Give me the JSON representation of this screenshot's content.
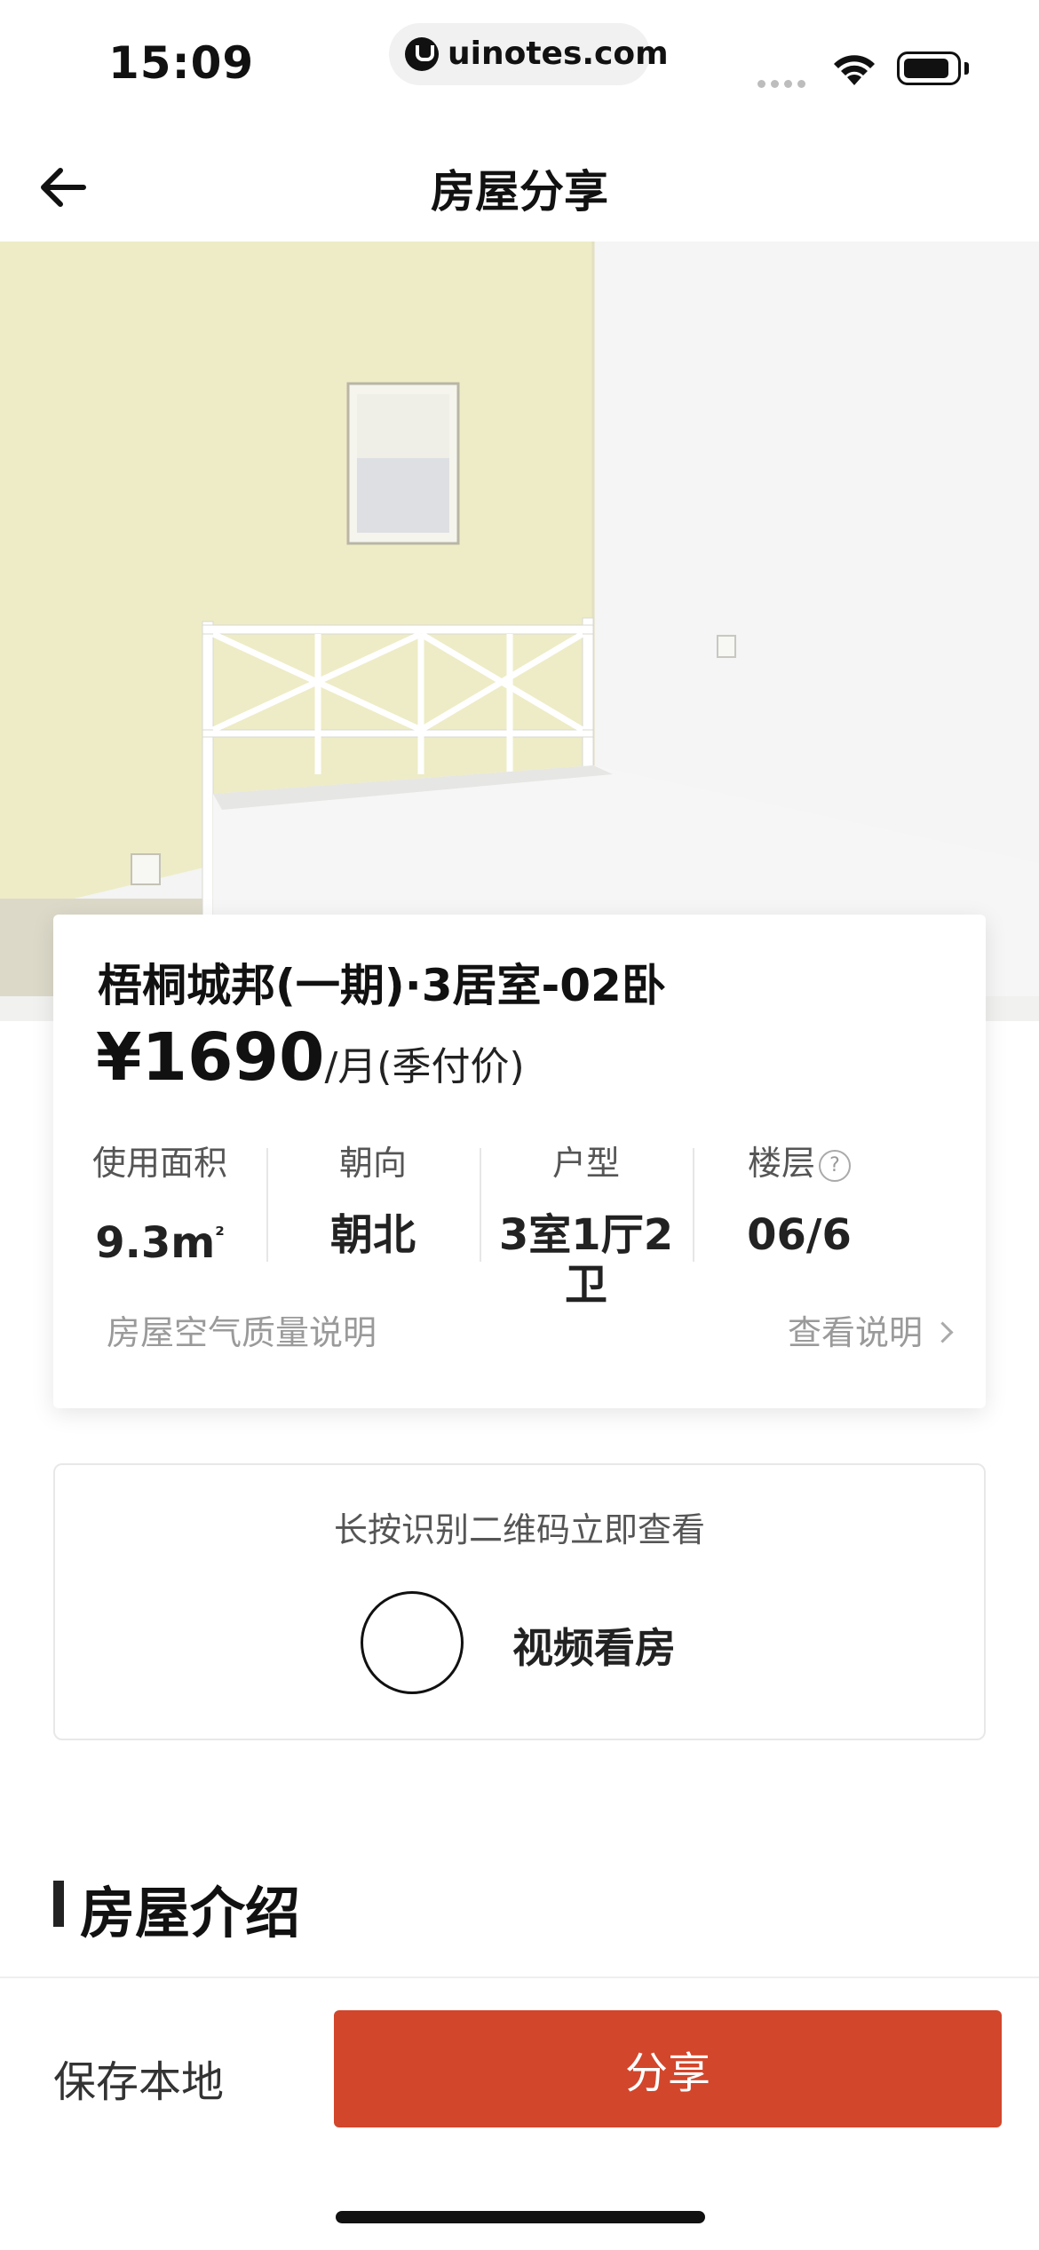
{
  "status_bar": {
    "time": "15:09",
    "url": "uinotes.com"
  },
  "navbar": {
    "title": "房屋分享"
  },
  "listing": {
    "title": "梧桐城邦(一期)·3居室-02卧",
    "price": "¥1690",
    "price_unit": "/月(季付价)",
    "specs": [
      {
        "label": "使用面积",
        "value": "9.3m",
        "value_sup": "²"
      },
      {
        "label": "朝向",
        "value": "朝北"
      },
      {
        "label": "户型",
        "value": "3室1厅2卫"
      },
      {
        "label": "楼层",
        "value": "06/6",
        "help": "?"
      }
    ],
    "air_quality_label": "房屋空气质量说明",
    "air_quality_link": "查看说明"
  },
  "video": {
    "hint": "长按识别二维码立即查看",
    "label": "视频看房"
  },
  "section": {
    "title": "房屋介绍"
  },
  "bottom": {
    "save_label": "保存本地",
    "share_label": "分享"
  },
  "colors": {
    "accent": "#d2462b",
    "wall_yellow": "#eeecc6",
    "wall_white": "#f2f3f2"
  },
  "icons": [
    "back-arrow-icon",
    "wifi-icon",
    "battery-icon",
    "help-circle-icon",
    "chevron-right-icon",
    "play-icon"
  ]
}
